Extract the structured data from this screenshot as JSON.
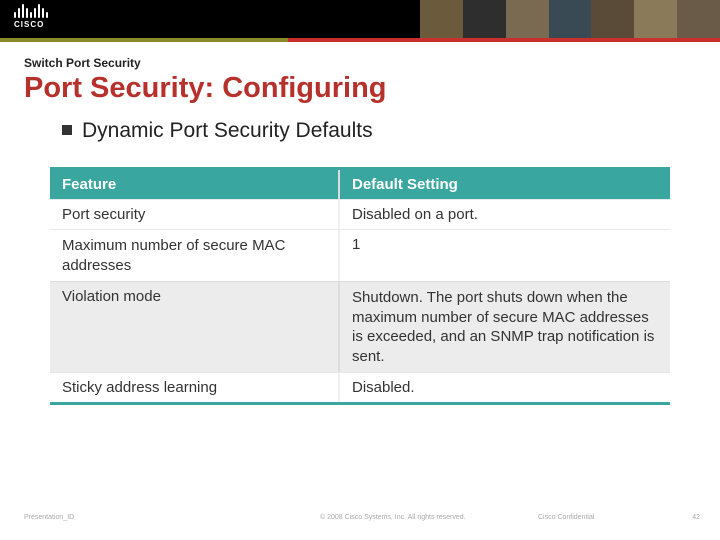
{
  "header": {
    "logo_text": "CISCO"
  },
  "slide": {
    "kicker": "Switch Port Security",
    "title": "Port Security: Configuring",
    "bullet": "Dynamic Port Security Defaults"
  },
  "table": {
    "head": {
      "feature": "Feature",
      "default": "Default Setting"
    },
    "rows": [
      {
        "feature": "Port security",
        "default": "Disabled on a port."
      },
      {
        "feature": "Maximum number of secure MAC addresses",
        "default": "1"
      },
      {
        "feature": "Violation mode",
        "default": "Shutdown. The port shuts down when the maximum number of secure MAC addresses is exceeded, and an SNMP trap notification is sent."
      },
      {
        "feature": "Sticky address learning",
        "default": "Disabled."
      }
    ]
  },
  "footer": {
    "presentation_id": "Presentation_ID",
    "copyright": "© 2008 Cisco Systems, Inc. All rights reserved.",
    "confidential": "Cisco Confidential",
    "page": "42"
  }
}
